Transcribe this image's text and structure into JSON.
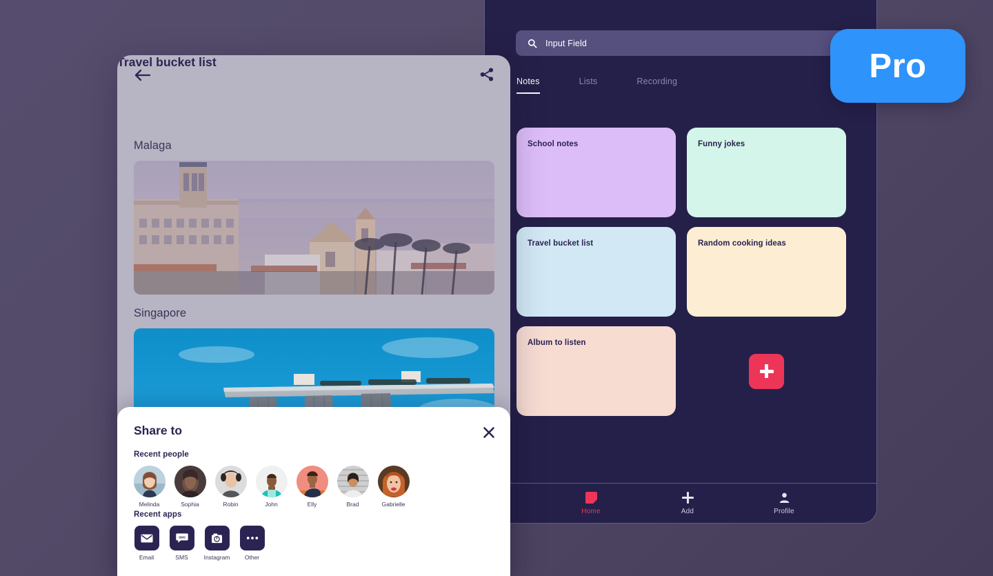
{
  "pro_badge": {
    "label": "Pro",
    "color": "#2e93fb"
  },
  "notes_panel": {
    "search": {
      "value": "Input Field",
      "icon": "search-icon"
    },
    "tabs": [
      {
        "label": "Notes",
        "active": true
      },
      {
        "label": "Lists",
        "active": false
      },
      {
        "label": "Recording",
        "active": false
      }
    ],
    "cards": [
      {
        "title": "School notes",
        "color": "#ddbdf7"
      },
      {
        "title": "Funny jokes",
        "color": "#d4f5e9"
      },
      {
        "title": "Travel bucket list",
        "color": "#d2e9f5"
      },
      {
        "title": "Random cooking ideas",
        "color": "#fdeed3"
      },
      {
        "title": "Album to listen",
        "color": "#f7dcd2"
      }
    ],
    "add_button": {
      "icon": "plus-icon",
      "color": "#ed3558"
    },
    "bottom_nav": [
      {
        "label": "Home",
        "icon": "note-icon",
        "active": true
      },
      {
        "label": "Add",
        "icon": "plus-icon",
        "active": false
      },
      {
        "label": "Profile",
        "icon": "person-icon",
        "active": false
      }
    ]
  },
  "detail_panel": {
    "back_icon": "arrow-left-icon",
    "share_icon": "share-icon",
    "title": "Travel bucket list",
    "places": [
      {
        "name": "Malaga",
        "photo": "malaga-cityscape-photo"
      },
      {
        "name": "Singapore",
        "photo": "singapore-marina-bay-sands-photo"
      }
    ]
  },
  "share_modal": {
    "title": "Share to",
    "close_icon": "close-icon",
    "recent_people_label": "Recent people",
    "people": [
      {
        "name": "Melinda"
      },
      {
        "name": "Sophia"
      },
      {
        "name": "Robin"
      },
      {
        "name": "John"
      },
      {
        "name": "Elly"
      },
      {
        "name": "Brad"
      },
      {
        "name": "Gabrielle"
      }
    ],
    "recent_apps_label": "Recent apps",
    "apps": [
      {
        "name": "Email",
        "icon": "envelope-icon"
      },
      {
        "name": "SMS",
        "icon": "sms-bubble-icon"
      },
      {
        "name": "Instagram",
        "icon": "camera-icon"
      },
      {
        "name": "Other",
        "icon": "ellipsis-icon"
      }
    ]
  }
}
